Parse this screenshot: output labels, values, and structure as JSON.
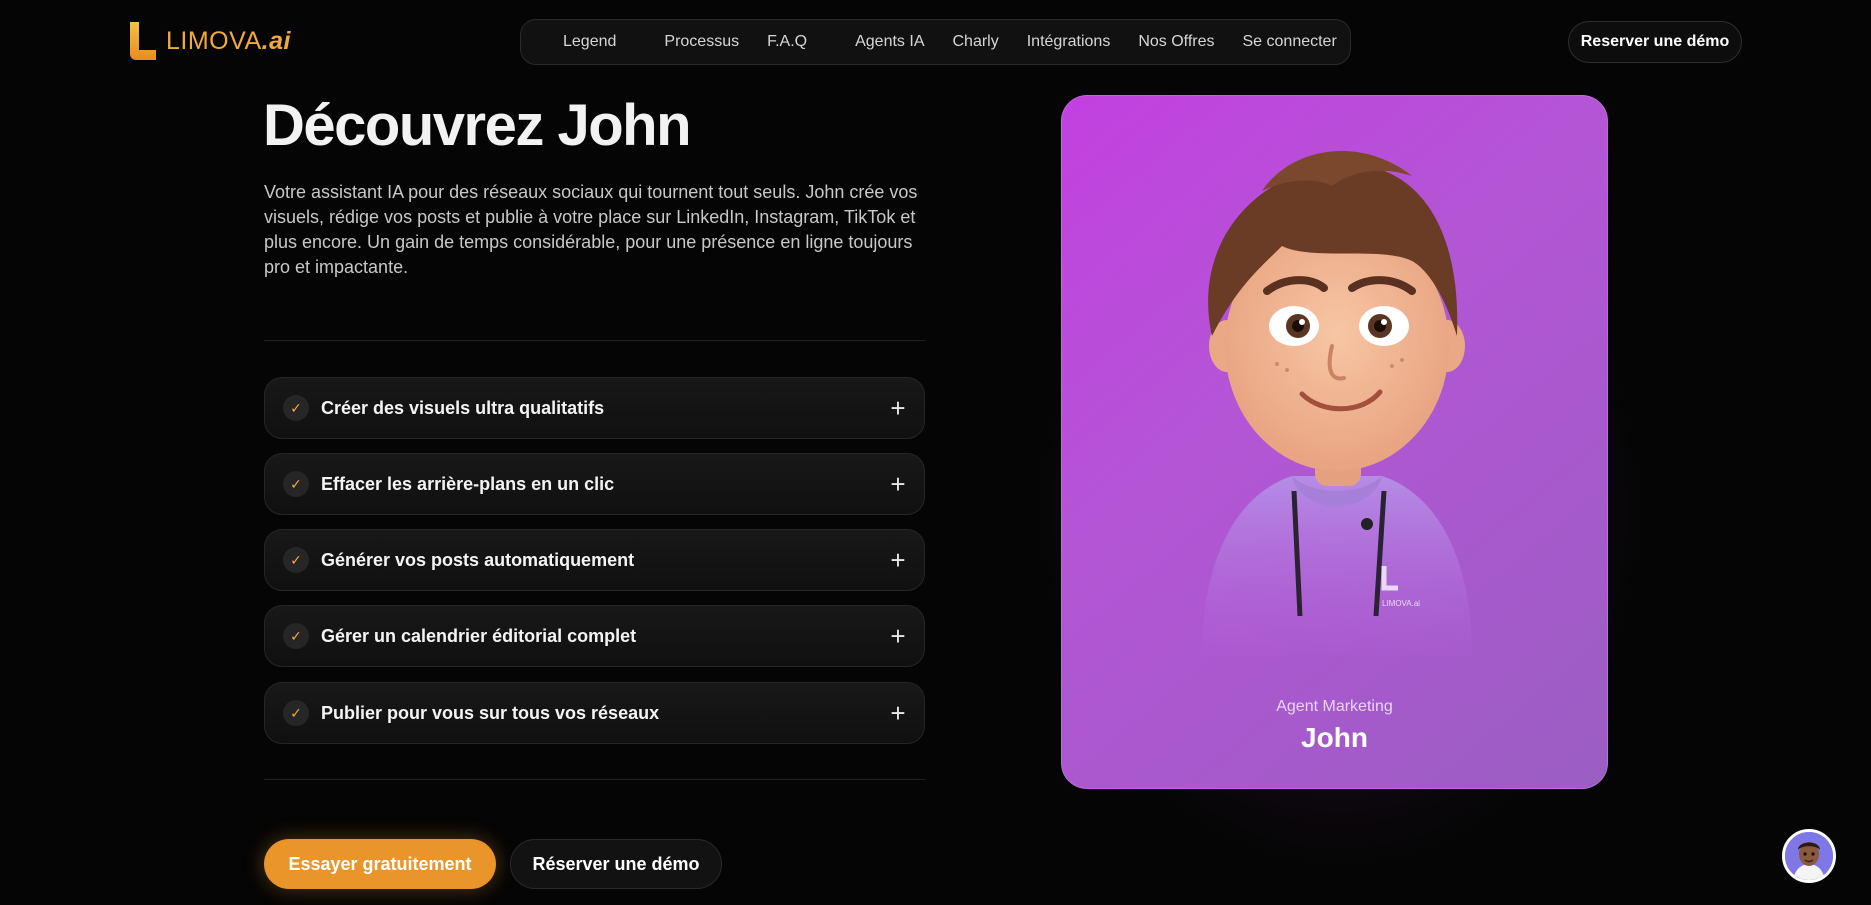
{
  "brand": {
    "logo_text": "LIMOVA",
    "logo_suffix": ".ai",
    "accent_color": "#f0a93a"
  },
  "nav": {
    "items": [
      {
        "label": "Legend"
      },
      {
        "label": "Processus"
      },
      {
        "label": "F.A.Q"
      },
      {
        "label": "Agents IA"
      },
      {
        "label": "Charly"
      },
      {
        "label": "Intégrations"
      },
      {
        "label": "Nos Offres"
      },
      {
        "label": "Se connecter"
      }
    ],
    "cta_label": "Reserver une démo"
  },
  "hero": {
    "title": "Découvrez John",
    "description": "Votre assistant IA pour des réseaux sociaux qui tournent tout seuls. John crée vos visuels, rédige vos posts et publie à votre place sur LinkedIn, Instagram, TikTok et plus encore. Un gain de temps considérable, pour une présence en ligne toujours pro et impactante.",
    "features": [
      {
        "label": "Créer des visuels ultra qualitatifs"
      },
      {
        "label": "Effacer les arrière-plans en un clic"
      },
      {
        "label": "Générer vos posts automatiquement"
      },
      {
        "label": "Gérer un calendrier éditorial complet"
      },
      {
        "label": "Publier pour vous sur tous vos réseaux"
      }
    ],
    "primary_cta": "Essayer gratuitement",
    "secondary_cta": "Réserver une démo"
  },
  "agent_card": {
    "role": "Agent Marketing",
    "name": "John",
    "hoodie_logo": "LIMOVA.ai",
    "card_color": "#c240e0"
  },
  "chat": {
    "icon": "chat-avatar-icon"
  }
}
